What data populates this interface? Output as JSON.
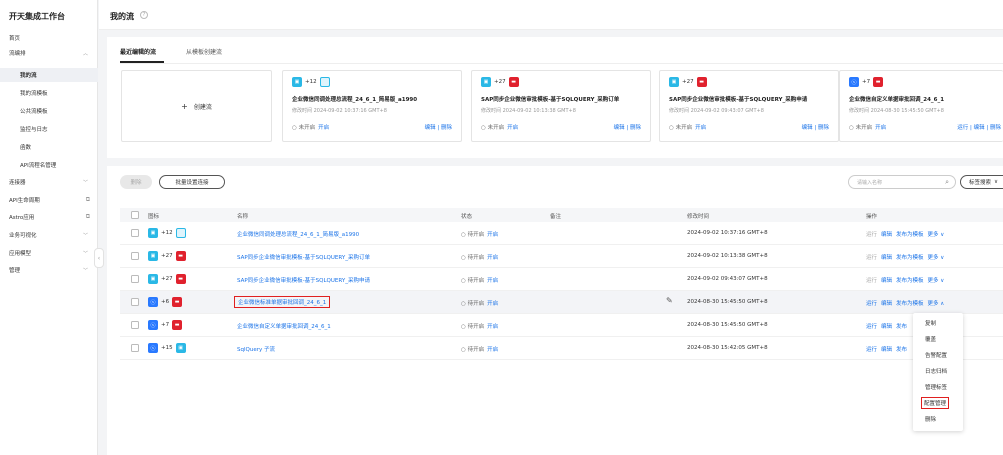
{
  "app": {
    "title": "开天集成工作台"
  },
  "sidebar": {
    "items": [
      {
        "label": "首页"
      },
      {
        "label": "流编排"
      },
      {
        "label": "我的流"
      },
      {
        "label": "我的流模板"
      },
      {
        "label": "公共流模板"
      },
      {
        "label": "监控与日志"
      },
      {
        "label": "函数"
      },
      {
        "label": "API流程名管理"
      },
      {
        "label": "连接器"
      },
      {
        "label": "API生命周期"
      },
      {
        "label": "Astro应用"
      },
      {
        "label": "业务可视化"
      },
      {
        "label": "应用模型"
      },
      {
        "label": "管理"
      }
    ]
  },
  "header": {
    "title": "我的流",
    "help_icon": "question-circle-icon"
  },
  "tabs": [
    {
      "label": "最近编辑的流"
    },
    {
      "label": "从模板创建流"
    }
  ],
  "cards": {
    "new_label": "创建流",
    "items": [
      {
        "count": "+12",
        "icons": [
          "teal",
          "outline"
        ],
        "title": "企业微信同调处理总流程_24_6_1_简易版_a1990",
        "modified": "修改时间  2024-09-02 10:37:16 GMT+8",
        "status": "未开启",
        "open": "开启",
        "actions": "编辑 | 删除"
      },
      {
        "count": "+27",
        "icons": [
          "teal",
          "red"
        ],
        "title": "SAP同步企业微信审批模板-基于SQLQUERY_采购订单",
        "modified": "修改时间  2024-09-02 10:13:38 GMT+8",
        "status": "未开启",
        "open": "开启",
        "actions": "编辑 | 删除"
      },
      {
        "count": "+27",
        "icons": [
          "teal",
          "red"
        ],
        "title": "SAP同步企业微信审批模板-基于SQLQUERY_采购申请",
        "modified": "修改时间  2024-09-02 09:43:07 GMT+8",
        "status": "未开启",
        "open": "开启",
        "actions": "编辑 | 删除"
      },
      {
        "count": "+7",
        "icons": [
          "blue",
          "red"
        ],
        "title": "企业微信自定义单据审批回调_24_6_1",
        "modified": "修改时间  2024-08-30 15:45:50 GMT+8",
        "status": "未开启",
        "open": "开启",
        "actions": "运行 | 编辑 | 删除"
      }
    ]
  },
  "toolbar": {
    "delete_label": "删除",
    "batch_label": "批量设置连接",
    "search_placeholder": "请输入名称",
    "tag_search_label": "标签搜索"
  },
  "table": {
    "headers": {
      "icon": "图标",
      "name": "名称",
      "status": "状态",
      "remark": "备注",
      "mtime": "修改时间",
      "ops": "操作"
    },
    "rows": [
      {
        "count": "+12",
        "icons": [
          "teal",
          "outline"
        ],
        "name": "企业微信同调处理总流程_24_6_1_简易版_a1990",
        "status": "待开启",
        "open": "开启",
        "mtime": "2024-09-02 10:37:16 GMT+8",
        "run": "运行",
        "edit": "编辑",
        "publish": "发布为模板",
        "more": "更多 ∨"
      },
      {
        "count": "+27",
        "icons": [
          "teal",
          "red"
        ],
        "name": "SAP同步企业微信审批模板-基于SQLQUERY_采购订单",
        "status": "待开启",
        "open": "开启",
        "mtime": "2024-09-02 10:13:38 GMT+8",
        "run": "运行",
        "edit": "编辑",
        "publish": "发布为模板",
        "more": "更多 ∨"
      },
      {
        "count": "+27",
        "icons": [
          "teal",
          "red"
        ],
        "name": "SAP同步企业微信审批模板-基于SQLQUERY_采购申请",
        "status": "待开启",
        "open": "开启",
        "mtime": "2024-09-02 09:43:07 GMT+8",
        "run": "运行",
        "edit": "编辑",
        "publish": "发布为模板",
        "more": "更多 ∨"
      },
      {
        "count": "+6",
        "icons": [
          "blue",
          "red"
        ],
        "name": "企业微信标准单据审批回调_24_6_1",
        "status": "待开启",
        "open": "开启",
        "mtime": "2024-08-30 15:45:50 GMT+8",
        "run": "运行",
        "edit": "编辑",
        "publish": "发布为模板",
        "more": "更多 ∧"
      },
      {
        "count": "+7",
        "icons": [
          "blue",
          "red"
        ],
        "name": "企业微信自定义单据审批回调_24_6_1",
        "status": "待开启",
        "open": "开启",
        "mtime": "2024-08-30 15:45:50 GMT+8",
        "run": "运行",
        "edit": "编辑",
        "publish": "发布",
        "more": ""
      },
      {
        "count": "+15",
        "icons": [
          "blue",
          "teal"
        ],
        "name": "SqlQuery 子流",
        "status": "待开启",
        "open": "开启",
        "mtime": "2024-08-30 15:42:05 GMT+8",
        "run": "运行",
        "edit": "编辑",
        "publish": "发布",
        "more": ""
      }
    ]
  },
  "dropdown": {
    "items": [
      {
        "label": "复制"
      },
      {
        "label": "覆盖"
      },
      {
        "label": "告警配置"
      },
      {
        "label": "日志归档"
      },
      {
        "label": "管理标签"
      },
      {
        "label": "配置管理"
      },
      {
        "label": "删除"
      }
    ]
  }
}
